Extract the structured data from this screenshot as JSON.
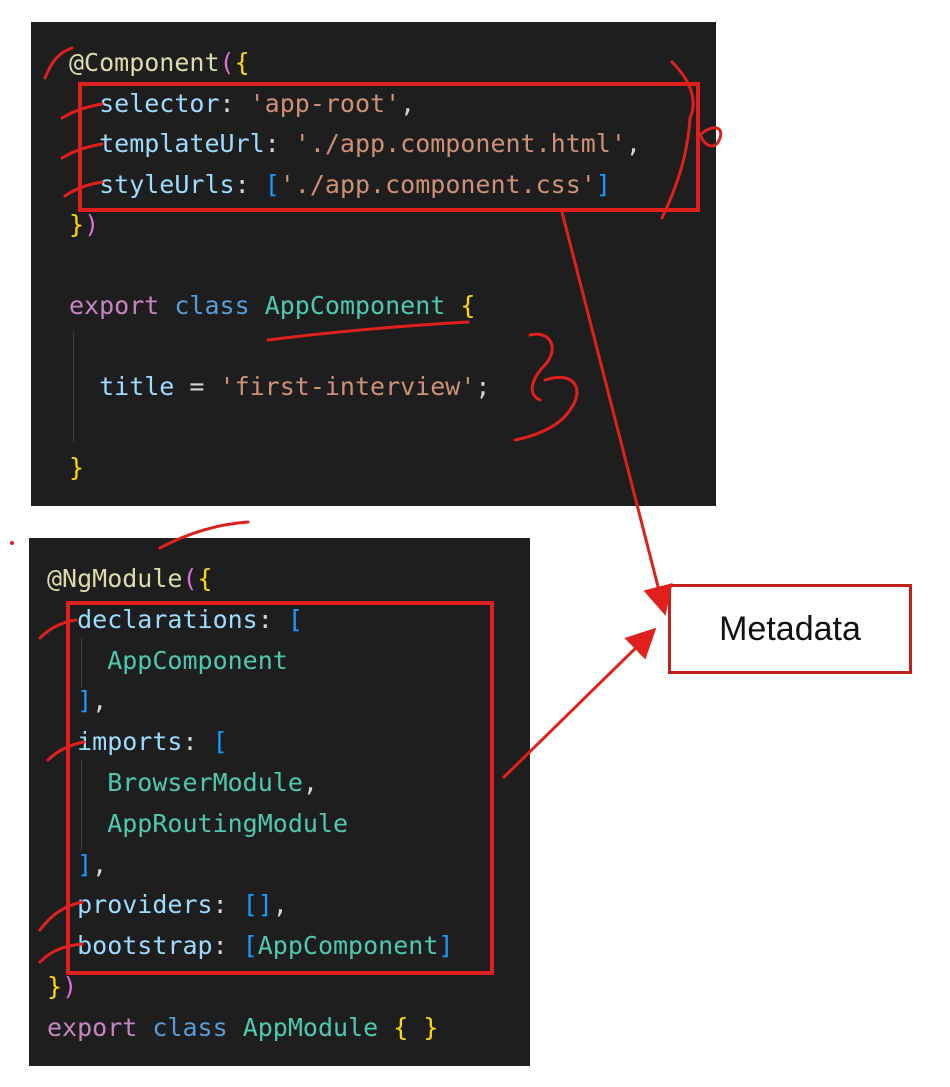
{
  "component_code": {
    "lines": [
      [
        {
          "t": "@Component",
          "c": "c-deco"
        },
        {
          "t": "(",
          "c": "c-bracket1"
        },
        {
          "t": "{",
          "c": "c-bracket2"
        }
      ],
      [
        {
          "t": "  selector",
          "c": "c-prop"
        },
        {
          "t": ": ",
          "c": "c-punct"
        },
        {
          "t": "'app-root'",
          "c": "c-string"
        },
        {
          "t": ",",
          "c": "c-punct"
        }
      ],
      [
        {
          "t": "  templateUrl",
          "c": "c-prop"
        },
        {
          "t": ": ",
          "c": "c-punct"
        },
        {
          "t": "'./app.component.html'",
          "c": "c-string"
        },
        {
          "t": ",",
          "c": "c-punct"
        }
      ],
      [
        {
          "t": "  styleUrls",
          "c": "c-prop"
        },
        {
          "t": ": ",
          "c": "c-punct"
        },
        {
          "t": "[",
          "c": "c-bracket3"
        },
        {
          "t": "'./app.component.css'",
          "c": "c-string"
        },
        {
          "t": "]",
          "c": "c-bracket3"
        }
      ],
      [
        {
          "t": "}",
          "c": "c-bracket2"
        },
        {
          "t": ")",
          "c": "c-bracket1"
        }
      ],
      [],
      [
        {
          "t": "export",
          "c": "c-keyword2"
        },
        {
          "t": " ",
          "c": "c-punct"
        },
        {
          "t": "class",
          "c": "c-keyword"
        },
        {
          "t": " ",
          "c": "c-punct"
        },
        {
          "t": "AppComponent",
          "c": "c-class"
        },
        {
          "t": " ",
          "c": "c-punct"
        },
        {
          "t": "{",
          "c": "c-bracket2"
        }
      ],
      [],
      [
        {
          "t": "  title",
          "c": "c-prop"
        },
        {
          "t": " = ",
          "c": "c-punct"
        },
        {
          "t": "'first-interview'",
          "c": "c-string"
        },
        {
          "t": ";",
          "c": "c-punct"
        }
      ],
      [],
      [
        {
          "t": "}",
          "c": "c-bracket2"
        }
      ]
    ]
  },
  "module_code": {
    "lines": [
      [
        {
          "t": "@NgModule",
          "c": "c-deco"
        },
        {
          "t": "(",
          "c": "c-bracket1"
        },
        {
          "t": "{",
          "c": "c-bracket2"
        }
      ],
      [
        {
          "t": "  declarations",
          "c": "c-prop"
        },
        {
          "t": ": ",
          "c": "c-punct"
        },
        {
          "t": "[",
          "c": "c-bracket3"
        }
      ],
      [
        {
          "t": "    AppComponent",
          "c": "c-class"
        }
      ],
      [
        {
          "t": "  ]",
          "c": "c-bracket3"
        },
        {
          "t": ",",
          "c": "c-punct"
        }
      ],
      [
        {
          "t": "  imports",
          "c": "c-prop"
        },
        {
          "t": ": ",
          "c": "c-punct"
        },
        {
          "t": "[",
          "c": "c-bracket3"
        }
      ],
      [
        {
          "t": "    BrowserModule",
          "c": "c-class"
        },
        {
          "t": ",",
          "c": "c-punct"
        }
      ],
      [
        {
          "t": "    AppRoutingModule",
          "c": "c-class"
        }
      ],
      [
        {
          "t": "  ]",
          "c": "c-bracket3"
        },
        {
          "t": ",",
          "c": "c-punct"
        }
      ],
      [
        {
          "t": "  providers",
          "c": "c-prop"
        },
        {
          "t": ": ",
          "c": "c-punct"
        },
        {
          "t": "[]",
          "c": "c-bracket3"
        },
        {
          "t": ",",
          "c": "c-punct"
        }
      ],
      [
        {
          "t": "  bootstrap",
          "c": "c-prop"
        },
        {
          "t": ": ",
          "c": "c-punct"
        },
        {
          "t": "[",
          "c": "c-bracket3"
        },
        {
          "t": "AppComponent",
          "c": "c-class"
        },
        {
          "t": "]",
          "c": "c-bracket3"
        }
      ],
      [
        {
          "t": "}",
          "c": "c-bracket2"
        },
        {
          "t": ")",
          "c": "c-bracket1"
        }
      ],
      [
        {
          "t": "export",
          "c": "c-keyword2"
        },
        {
          "t": " ",
          "c": "c-punct"
        },
        {
          "t": "class",
          "c": "c-keyword"
        },
        {
          "t": " ",
          "c": "c-punct"
        },
        {
          "t": "AppModule",
          "c": "c-class"
        },
        {
          "t": " ",
          "c": "c-punct"
        },
        {
          "t": "{ }",
          "c": "c-bracket2"
        }
      ]
    ]
  },
  "annotation": {
    "label": "Metadata",
    "color": "#e0201c"
  }
}
